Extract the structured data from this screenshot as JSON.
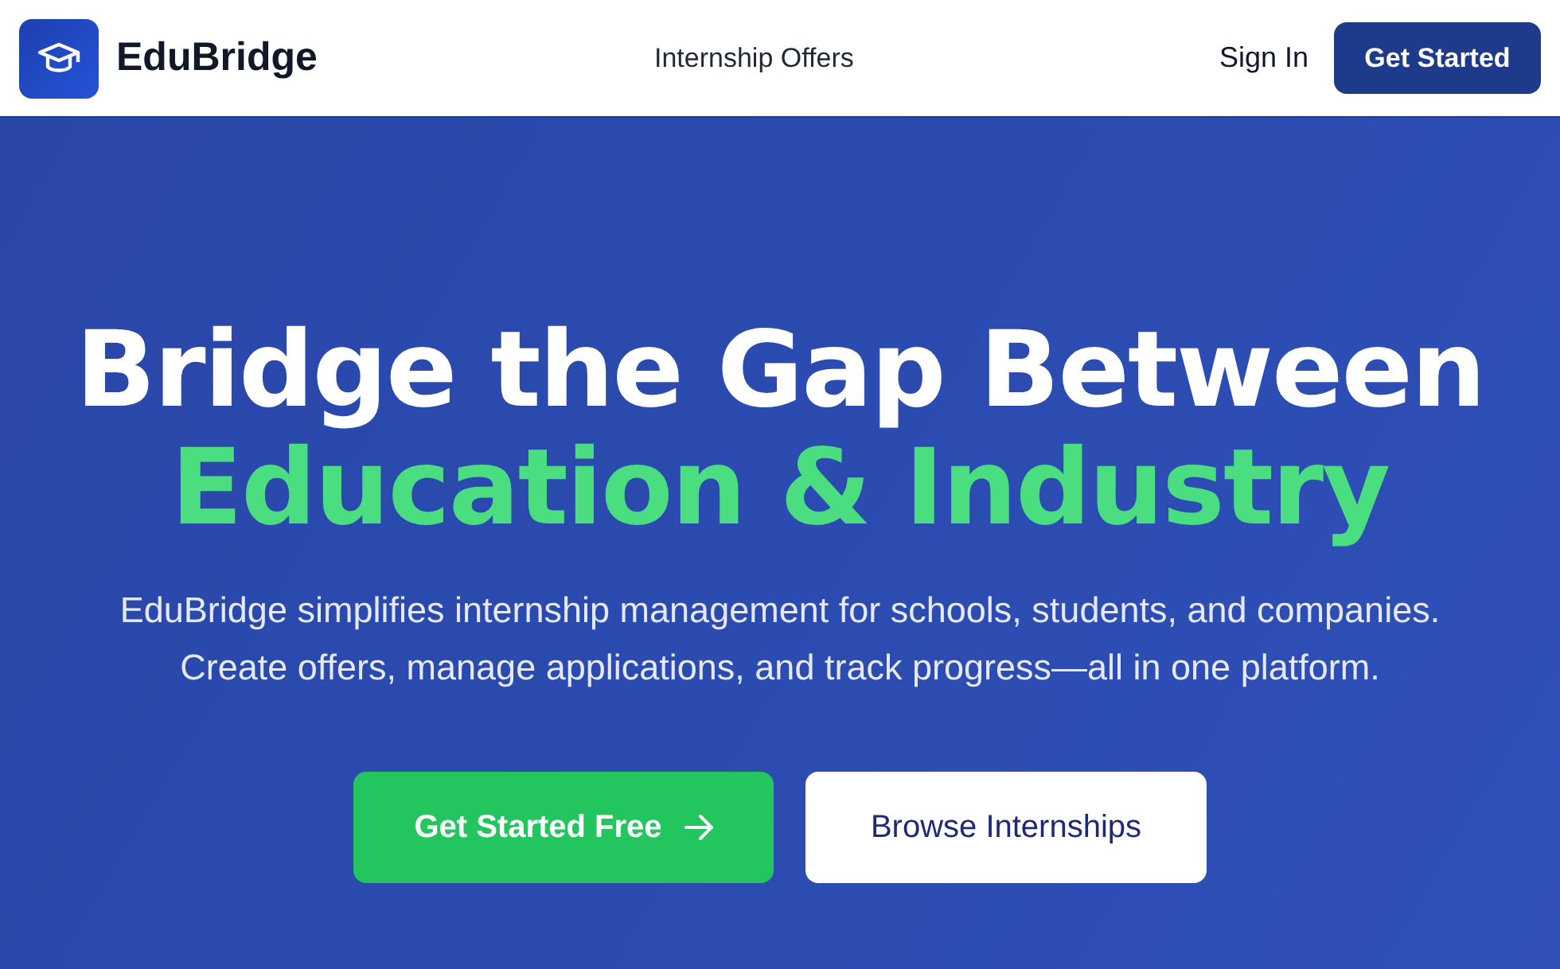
{
  "brand": {
    "name": "EduBridge"
  },
  "nav": {
    "links": [
      {
        "label": "Internship Offers"
      }
    ],
    "sign_in": "Sign In",
    "get_started": "Get Started"
  },
  "hero": {
    "title_line_1": "Bridge the Gap Between",
    "title_line_2": "Education & Industry",
    "description": "EduBridge simplifies internship management for schools, students, and companies. Create offers, manage applications, and track progress—all in one platform.",
    "buttons": [
      {
        "kind": "primary",
        "label": "Get Started Free"
      },
      {
        "kind": "secondary",
        "label": "Browse Internships"
      }
    ]
  }
}
